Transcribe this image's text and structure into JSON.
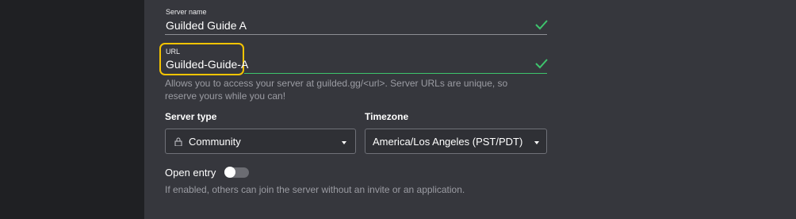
{
  "server_name": {
    "label": "Server name",
    "value": "Guilded Guide A",
    "valid_icon": "check-icon"
  },
  "url": {
    "label": "URL",
    "value": "Guilded-Guide-A",
    "valid_icon": "check-icon",
    "help": "Allows you to access your server at guilded.gg/<url>. Server URLs are unique, so reserve yours while you can!"
  },
  "server_type": {
    "label": "Server type",
    "value": "Community",
    "icon": "lock-icon"
  },
  "timezone": {
    "label": "Timezone",
    "value": "America/Los Angeles (PST/PDT)"
  },
  "open_entry": {
    "label": "Open entry",
    "enabled": false,
    "help": "If enabled, others can join the server without an invite or an application."
  },
  "colors": {
    "background": "#36373d",
    "sidebar": "#1f2023",
    "valid_green": "#3ec46d",
    "highlight": "#f5c400"
  }
}
